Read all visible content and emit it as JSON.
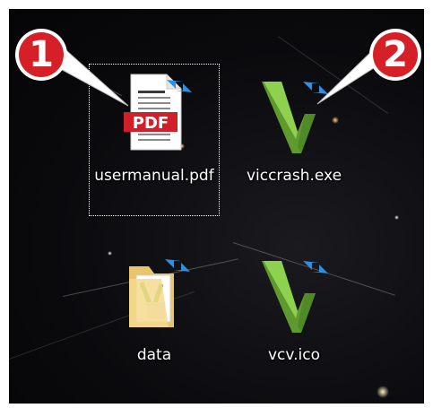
{
  "desktop": {
    "icons": [
      {
        "label": "usermanual.pdf",
        "type": "pdf-file-icon",
        "selected": true
      },
      {
        "label": "viccrash.exe",
        "type": "vicinity-app-icon",
        "selected": false
      },
      {
        "label": "data",
        "type": "folder-shortcut-icon",
        "selected": false
      },
      {
        "label": "vcv.ico",
        "type": "vicinity-ico-icon",
        "selected": false
      }
    ]
  },
  "callouts": [
    {
      "number": "1",
      "color": "#d62027"
    },
    {
      "number": "2",
      "color": "#d62027"
    }
  ],
  "colors": {
    "pdf_red": "#d0202a",
    "vicinity_green": "#7cc142",
    "shortcut_blue": "#2f8fe0",
    "callout_red": "#d62027"
  }
}
